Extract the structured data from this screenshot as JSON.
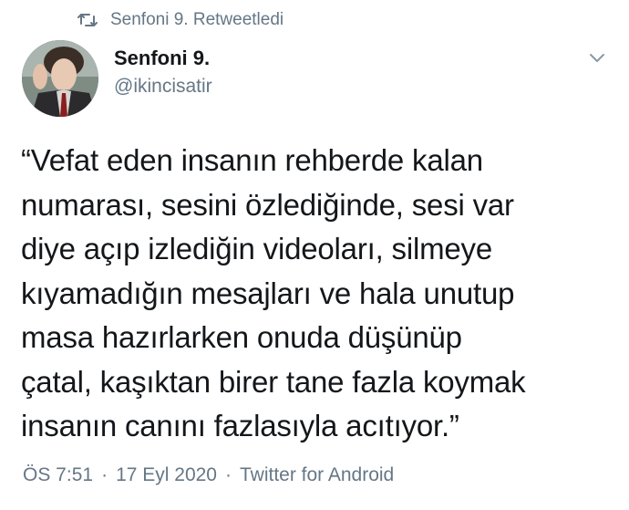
{
  "retweet": {
    "label": "Senfoni 9. Retweetledi",
    "icon": "retweet-icon"
  },
  "author": {
    "name": "Senfoni 9.",
    "handle": "@ikincisatir",
    "avatar": "avatar-photo"
  },
  "menu": {
    "icon": "chevron-down-icon"
  },
  "tweet": {
    "text": "“Vefat eden insanın rehberde kalan\nnumarası, sesini özlediğinde, sesi var\ndiye açıp izlediğin videoları, silmeye\nkıyamadığın mesajları ve hala unutup\nmasa hazırlarken onuda düşünüp\nçatal, kaşıktan birer tane fazla koymak\ninsanın canını fazlasıyla acıtıyor.”"
  },
  "meta": {
    "time": "ÖS 7:51",
    "date": "17 Eyl 2020",
    "source": "Twitter for Android",
    "separator": "·"
  },
  "colors": {
    "text": "#14171a",
    "secondary": "#657786",
    "background": "#ffffff"
  }
}
